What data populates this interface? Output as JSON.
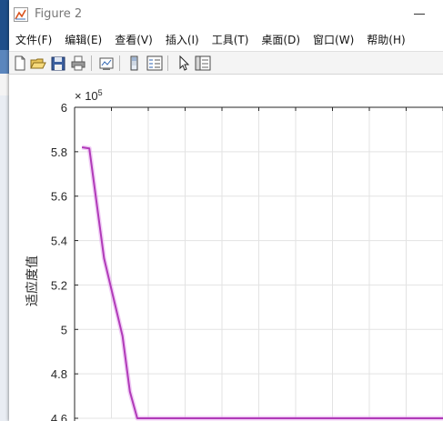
{
  "window": {
    "title": "Figure 2"
  },
  "menu": {
    "items": [
      "文件(F)",
      "编辑(E)",
      "查看(V)",
      "插入(I)",
      "工具(T)",
      "桌面(D)",
      "窗口(W)",
      "帮助(H)"
    ]
  },
  "toolbar": {
    "icons": [
      "new-figure-icon",
      "open-file-icon",
      "save-icon",
      "print-icon",
      "link-plot-icon",
      "colorbar-icon",
      "legend-icon",
      "edit-plot-arrow-icon",
      "property-inspector-icon"
    ]
  },
  "colors": {
    "line": "#b03ab8",
    "line_glow": "#e6a6ef",
    "grid": "#e3e3e3",
    "axis": "#262626"
  },
  "chart_data": {
    "type": "line",
    "title": "",
    "xlabel": "",
    "ylabel": "适应度值",
    "y_exponent_label": "× 10^5",
    "y_multiplier": 100000,
    "ylim": [
      4.6,
      6
    ],
    "yticks": [
      "4.6",
      "4.8",
      "5",
      "5.2",
      "5.4",
      "5.6",
      "5.8",
      "6"
    ],
    "xlim": [
      0,
      100
    ],
    "x_grid": [
      0,
      10,
      20,
      30,
      40,
      50,
      60,
      70,
      80,
      90,
      100
    ],
    "grid": true,
    "series": [
      {
        "x": [
          2,
          4,
          8,
          10,
          13,
          15,
          17,
          18,
          20,
          100
        ],
        "y": [
          5.82,
          5.815,
          5.32,
          5.18,
          4.97,
          4.72,
          4.6,
          4.6,
          4.6,
          4.6
        ]
      }
    ]
  }
}
